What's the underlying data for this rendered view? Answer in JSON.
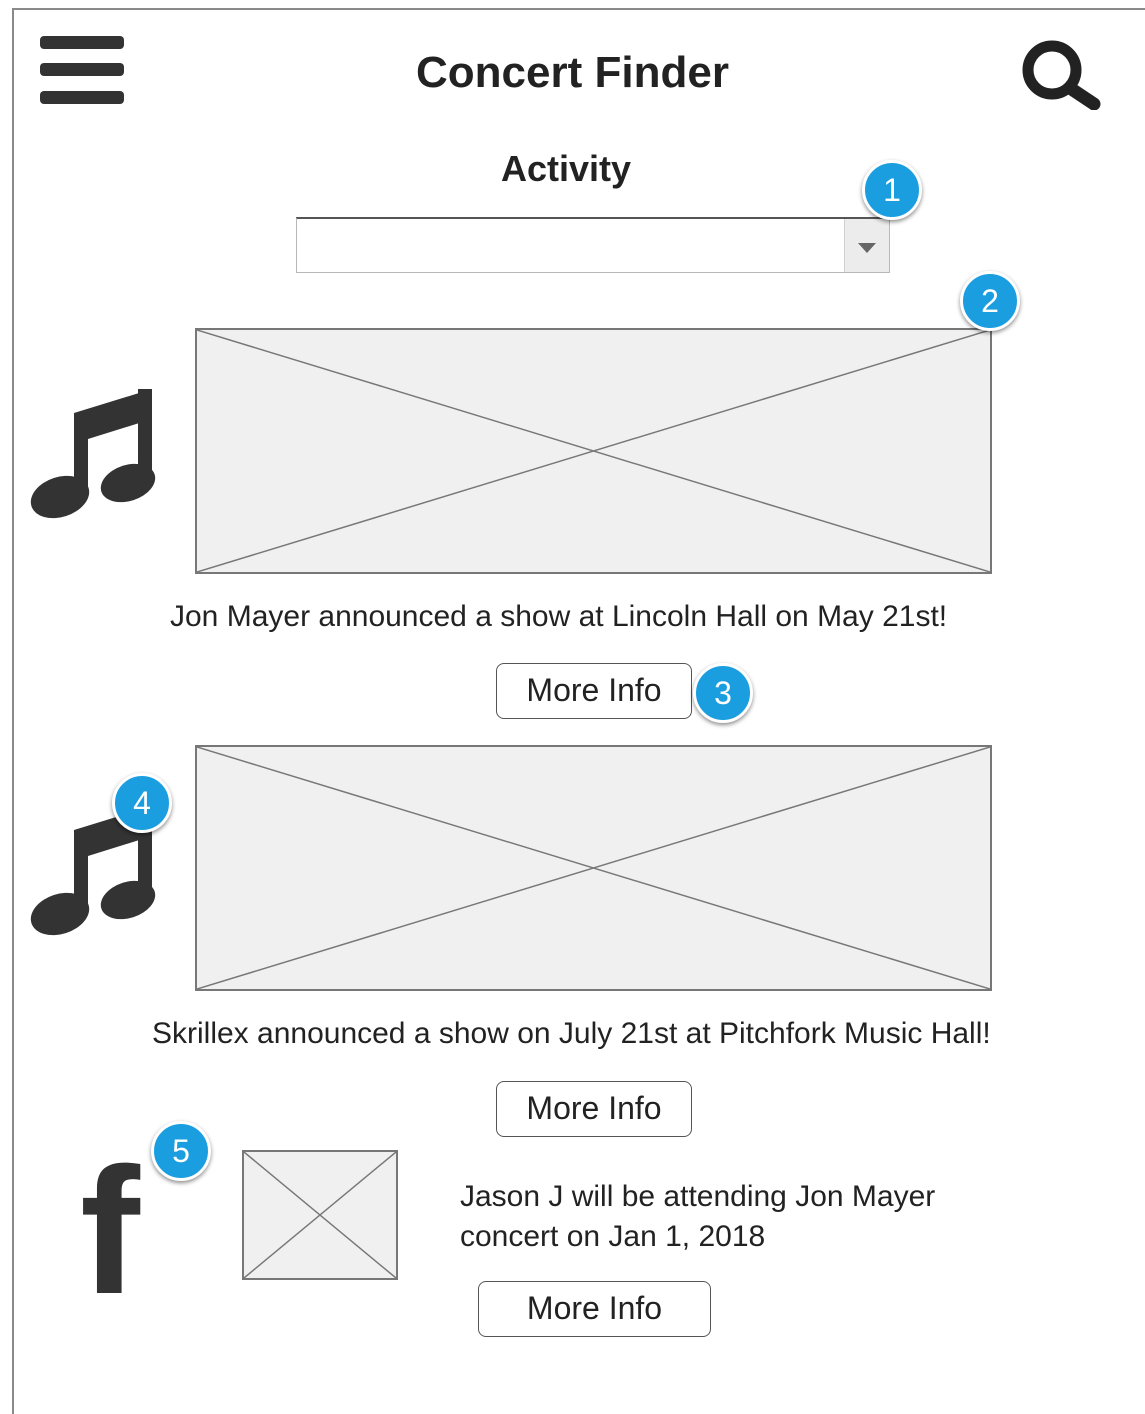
{
  "header": {
    "title": "Concert Finder",
    "menu_icon": "hamburger-menu-icon",
    "search_icon": "search-icon"
  },
  "activity": {
    "label": "Activity",
    "selected_value": "",
    "arrow_icon": "caret-down-icon"
  },
  "feed": [
    {
      "type_icon": "music-note-icon",
      "image": "image-placeholder",
      "text": "Jon Mayer announced a show at Lincoln Hall on May 21st!",
      "button_label": "More Info"
    },
    {
      "type_icon": "music-note-icon",
      "image": "image-placeholder",
      "text": "Skrillex announced a show on July 21st at Pitchfork Music Hall!",
      "button_label": "More Info"
    },
    {
      "type_icon": "facebook-icon",
      "icon_letter": "f",
      "image": "image-placeholder",
      "text_line1": "Jason J will be attending Jon Mayer",
      "text_line2": "concert on Jan 1, 2018",
      "button_label": "More Info"
    }
  ],
  "annotations": [
    "1",
    "2",
    "3",
    "4",
    "5"
  ],
  "colors": {
    "badge": "#1a9ee0",
    "icon": "#333333",
    "placeholder_fill": "#f0f0f0"
  }
}
